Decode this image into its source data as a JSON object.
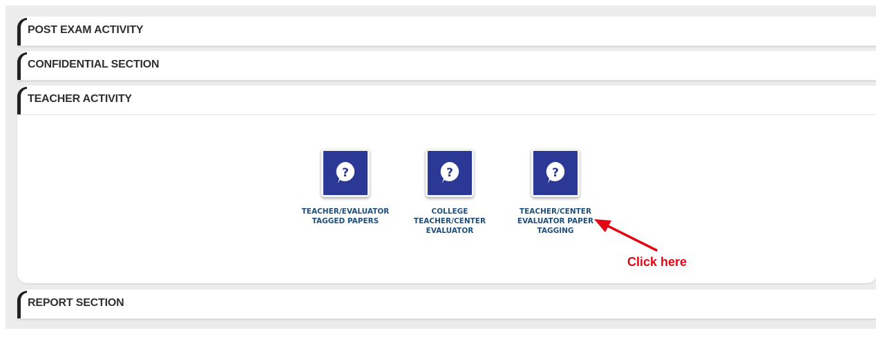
{
  "sections": [
    {
      "title": "POST EXAM ACTIVITY"
    },
    {
      "title": "CONFIDENTIAL SECTION"
    },
    {
      "title": "TEACHER ACTIVITY"
    },
    {
      "title": "REPORT SECTION"
    }
  ],
  "teacher_activity": {
    "tiles": [
      {
        "label_lines": [
          "TEACHER/EVALUATOR",
          "TAGGED PAPERS"
        ],
        "icon": "question-bubble-icon"
      },
      {
        "label_lines": [
          "COLLEGE",
          "TEACHER/CENTER",
          "EVALUATOR"
        ],
        "icon": "question-bubble-icon"
      },
      {
        "label_lines": [
          "TEACHER/CENTER",
          "EVALUATOR PAPER",
          "TAGGING"
        ],
        "icon": "question-bubble-icon"
      }
    ]
  },
  "annotation": {
    "text": "Click here",
    "color": "#e30613"
  },
  "colors": {
    "tile_background": "#2b3896",
    "tile_label": "#1e4f7c",
    "page_background": "#ececec"
  }
}
